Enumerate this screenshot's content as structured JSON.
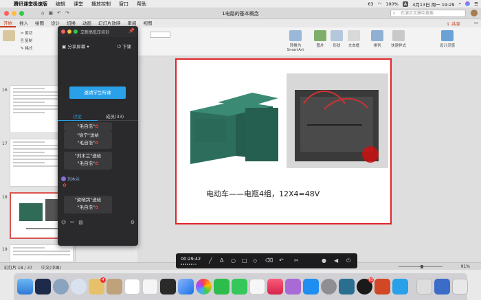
{
  "menubar": {
    "app_name": "腾讯课堂极速版",
    "items": [
      "编辑",
      "课堂",
      "播放控制",
      "窗口",
      "帮助"
    ],
    "battery": "63",
    "battery_pct": "100%",
    "input_method": "A",
    "clock": "4月13日 周一  19:29"
  },
  "window": {
    "doc_title": "1电路的基本概念",
    "search_placeholder": "在演示文稿中搜索"
  },
  "ribbon_tabs": [
    "开始",
    "插入",
    "绘图",
    "设计",
    "切换",
    "动画",
    "幻灯片放映",
    "审阅",
    "视图"
  ],
  "ribbon_actions": {
    "share": "共享",
    "comment": ""
  },
  "ribbon": {
    "cut": "剪切",
    "copy": "复制",
    "format": "格式",
    "convert_smartart": "转换为 SmartArt",
    "picture": "图片",
    "shape": "形状",
    "textbox": "文本框",
    "arrange": "排列",
    "quick_styles": "快速样式",
    "design_ideas": "设计灵感"
  },
  "slides_panel": {
    "numbers": [
      "16",
      "17",
      "18",
      "19"
    ]
  },
  "slide": {
    "caption": "电动车——电瓶4组，12X4=48V"
  },
  "classroom": {
    "window_title": "立新高低压培训",
    "share_screen": "分享屏幕",
    "end_class": "下课",
    "invite_button": "邀请学生听课",
    "tab_chat": "讨论",
    "tab_members": "成员(33)",
    "messages": [
      {
        "text": "\"毛自浩\""
      },
      {
        "text": "\"徐宁\"送给"
      },
      {
        "text": "\"毛自浩\""
      },
      {
        "text": "\"刘木兰\"送给"
      },
      {
        "text": "\"毛自浩\""
      },
      {
        "text": "\"梁晓鸽\"送给"
      },
      {
        "text": "\"毛自浩\""
      }
    ],
    "user_name": "刘木兰"
  },
  "status_bar": {
    "slide_info": "幻灯片 18 / 37",
    "language": "中文(中国)",
    "zoom": "91%"
  },
  "recorder": {
    "time": "00:29:42"
  },
  "dock": {
    "badges": {
      "mail": "4",
      "qq": "63"
    }
  },
  "colors": {
    "accent_red": "#c43e1c",
    "slide_border": "#e0242a",
    "invite_blue": "#2aa0e8"
  }
}
